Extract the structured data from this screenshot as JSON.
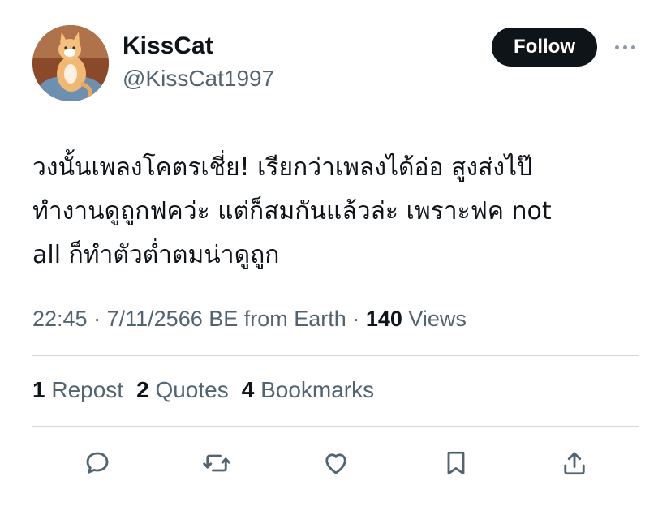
{
  "author": {
    "display_name": "KissCat",
    "handle": "@KissCat1997",
    "avatar_icon": "cat-avatar"
  },
  "header": {
    "follow_label": "Follow",
    "more_icon": "more-dots-icon"
  },
  "tweet": {
    "lines": [
      "วงนั้นเพลงโคตรเชี่ย! เรียกว่าเพลงได้อ่อ สูงส่งไป๊",
      "ทำงานดูถูกฟคว่ะ แต่ก็สมกันแล้วล่ะ เพราะฟค not",
      "all ก็ทำตัวต่ำตมน่าดูถูก"
    ]
  },
  "meta": {
    "time": "22:45",
    "separator": "·",
    "date": "7/11/2566 BE from Earth",
    "views_count": "140",
    "views_label": "Views"
  },
  "stats": {
    "reposts_count": "1",
    "reposts_label": "Repost",
    "quotes_count": "2",
    "quotes_label": "Quotes",
    "bookmarks_count": "4",
    "bookmarks_label": "Bookmarks"
  },
  "actions": [
    "reply-icon",
    "repost-icon",
    "like-icon",
    "bookmark-icon",
    "share-icon"
  ],
  "colors": {
    "text_primary": "#0f1419",
    "text_secondary": "#536471",
    "icon": "#536471",
    "divider": "#cfd9de",
    "button_bg": "#0f1419"
  }
}
